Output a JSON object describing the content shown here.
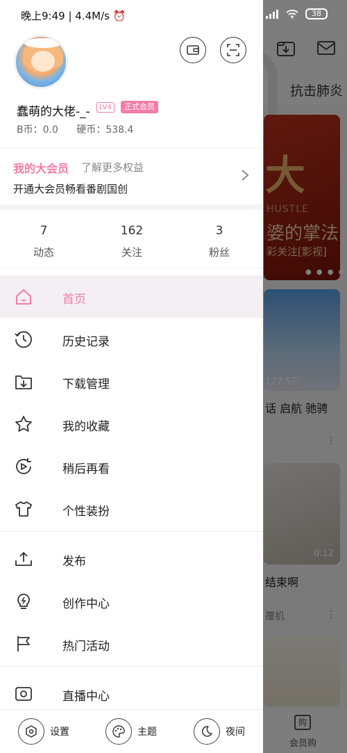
{
  "status": {
    "time_speed": "晚上9:49 | 4.4M/s",
    "battery": "38"
  },
  "profile": {
    "username": "蠢萌的大佬-_-",
    "level": "LV4",
    "vip_label": "正式会员",
    "b_coin": "B币：0.0",
    "coin": "硬币：538.4"
  },
  "vip": {
    "title": "我的大会员",
    "more": "了解更多权益",
    "desc": "开通大会员畅看番剧国创"
  },
  "stats": [
    {
      "value": "7",
      "label": "动态"
    },
    {
      "value": "162",
      "label": "关注"
    },
    {
      "value": "3",
      "label": "粉丝"
    }
  ],
  "menu": [
    {
      "label": "首页",
      "icon": "home-icon",
      "active": true
    },
    {
      "label": "历史记录",
      "icon": "history-icon"
    },
    {
      "label": "下载管理",
      "icon": "download-folder-icon"
    },
    {
      "label": "我的收藏",
      "icon": "star-icon"
    },
    {
      "label": "稍后再看",
      "icon": "watch-later-icon"
    },
    {
      "label": "个性装扮",
      "icon": "tshirt-icon"
    },
    {
      "label": "发布",
      "icon": "upload-icon"
    },
    {
      "label": "创作中心",
      "icon": "lightbulb-icon"
    },
    {
      "label": "热门活动",
      "icon": "flag-icon"
    },
    {
      "label": "直播中心",
      "icon": "live-icon"
    }
  ],
  "footer": {
    "settings": "设置",
    "theme": "主题",
    "night": "夜间"
  },
  "background": {
    "tab_label": "抗击肺炎",
    "card1_title": "大",
    "card1_sub1": "HUSTLE",
    "card1_sub2": "婆的掌法",
    "card1_sub3": "彩关注[影视]",
    "card2_count": "127.5万",
    "card2_title": "话 启航 驰骋",
    "card3_duration": "0:12",
    "card3_title": "结束啊",
    "card3_meta": "覆机",
    "bottom_label": "会员购",
    "bottom_icon_text": "购"
  },
  "colors": {
    "accent": "#f47ca6",
    "active_bg": "#f3eff2"
  }
}
